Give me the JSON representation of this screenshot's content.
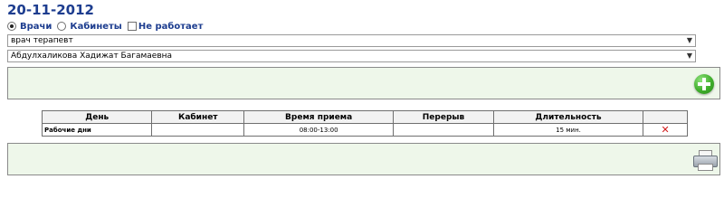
{
  "date_title": "20-11-2012",
  "filters": {
    "doctors_label": "Врачи",
    "doctors_checked": true,
    "cabinets_label": "Кабинеты",
    "cabinets_checked": false,
    "not_working_label": "Не работает",
    "not_working_checked": false
  },
  "selects": {
    "specialty_value": "врач терапевт",
    "doctor_value": "Абдулхаликова Хадижат Багамаевна"
  },
  "icons": {
    "add": "plus-circle-icon",
    "delete": "red-x-icon",
    "print": "printer-icon",
    "dropdown": "chevron-down-icon"
  },
  "colors": {
    "title": "#1d3d8f",
    "panel_bg": "#eef7ea",
    "add_green": "#3fae2b",
    "delete_red": "#d11a1a"
  },
  "table": {
    "headers": [
      "День",
      "Кабинет",
      "Время приема",
      "Перерыв",
      "Длительность",
      ""
    ],
    "rows": [
      {
        "day": "Рабочие дни",
        "cabinet": "",
        "time": "08:00-13:00",
        "break": "",
        "duration": "15 мин."
      }
    ]
  }
}
